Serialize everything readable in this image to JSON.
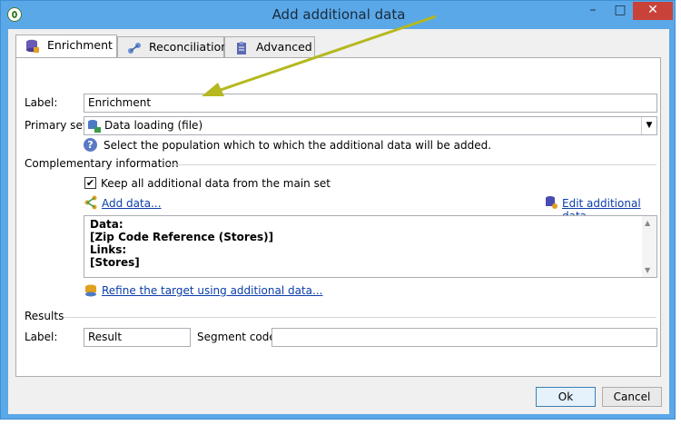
{
  "window": {
    "title": "Add additional data",
    "minimize": "–",
    "maximize": "□",
    "close": "✕"
  },
  "tabs": [
    {
      "label": "Enrichment",
      "active": true,
      "icon": "enrichment-icon"
    },
    {
      "label": "Reconciliation",
      "active": false,
      "icon": "reconciliation-icon"
    },
    {
      "label": "Advanced",
      "active": false,
      "icon": "advanced-icon"
    }
  ],
  "form": {
    "label_caption": "Label:",
    "label_value": "Enrichment",
    "primary_set_caption": "Primary set:",
    "primary_set_value": "Data loading (file)",
    "help_text": "Select the population which to which the additional data will be added."
  },
  "complementary": {
    "heading": "Complementary information",
    "keep_all_label": "Keep all additional data from the main set",
    "keep_all_checked": true,
    "add_data_link": "Add data...",
    "edit_data_link": "Edit additional data...",
    "memo_lines": [
      "Data:",
      " [Zip Code Reference (Stores)]",
      "Links:",
      " [Stores]"
    ],
    "refine_link": "Refine the target using additional data..."
  },
  "results": {
    "heading": "Results",
    "label_caption": "Label:",
    "label_value": "Result",
    "segment_caption": "Segment code:",
    "segment_value": ""
  },
  "footer": {
    "ok_label": "Ok",
    "cancel_label": "Cancel"
  },
  "colors": {
    "title_bar": "#5aa8e8",
    "close_button": "#c9423a",
    "link": "#0b3da8",
    "annotation_arrow": "#b5b81e"
  }
}
